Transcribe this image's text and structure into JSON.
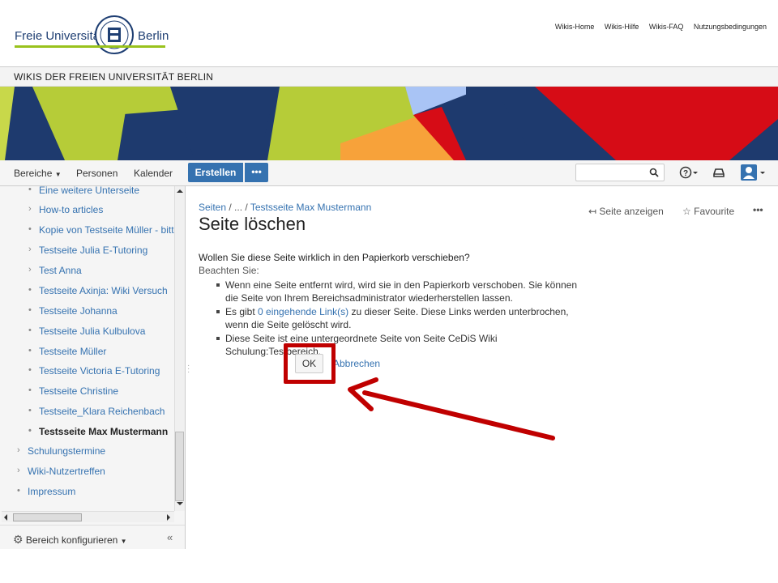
{
  "logo": {
    "left_text": "Freie Universität",
    "right_text": "Berlin"
  },
  "top_links": [
    "Wikis-Home",
    "Wikis-Hilfe",
    "Wikis-FAQ",
    "Nutzungsbedingungen"
  ],
  "wiki_title": "WIKIS DER FREIEN UNIVERSITÄT BERLIN",
  "nav": {
    "spaces": "Bereiche",
    "people": "Personen",
    "calendar": "Kalender",
    "create": "Erstellen",
    "more": "•••",
    "search_placeholder": ""
  },
  "sidebar": {
    "items": [
      {
        "label": "Eine weitere Unterseite",
        "mark": "•"
      },
      {
        "label": "How-to articles",
        "mark": "›"
      },
      {
        "label": "Kopie von Testseite Müller - bitte",
        "mark": "•"
      },
      {
        "label": "Testseite Julia E-Tutoring",
        "mark": "›"
      },
      {
        "label": "Test Anna",
        "mark": "›"
      },
      {
        "label": "Testseite Axinja: Wiki Versuch",
        "mark": "•"
      },
      {
        "label": "Testseite Johanna",
        "mark": "•"
      },
      {
        "label": "Testseite Julia Kulbulova",
        "mark": "•"
      },
      {
        "label": "Testseite Müller",
        "mark": "•"
      },
      {
        "label": "Testseite Victoria E-Tutoring",
        "mark": "•"
      },
      {
        "label": "Testseite Christine",
        "mark": "•"
      },
      {
        "label": "Testseite_Klara Reichenbach",
        "mark": "•"
      },
      {
        "label": "Testsseite Max Mustermann",
        "mark": "•"
      },
      {
        "label": "Schulungstermine",
        "mark": "›"
      },
      {
        "label": "Wiki-Nutzertreffen",
        "mark": "›"
      },
      {
        "label": "Impressum",
        "mark": "•"
      }
    ],
    "configure": "Bereich konfigurieren",
    "collapse": "«"
  },
  "breadcrumb": {
    "root": "Seiten",
    "ellipsis": "...",
    "current": "Testsseite Max Mustermann"
  },
  "page": {
    "title": "Seite löschen",
    "view_page": "Seite anzeigen",
    "favourite": "Favourite",
    "question": "Wollen Sie diese Seite wirklich in den Papierkorb verschieben?",
    "note_label": "Beachten Sie:",
    "bullet1": "Wenn eine Seite entfernt wird, wird sie in den Papierkorb verschoben. Sie können die Seite von Ihrem Bereichsadministrator wiederherstellen lassen.",
    "bullet2_pre": "Es gibt ",
    "bullet2_link": "0 eingehende Link(s)",
    "bullet2_post": " zu dieser Seite. Diese Links werden unterbrochen, wenn die Seite gelöscht wird.",
    "bullet3": "Diese Seite ist eine untergeordnete Seite von Seite CeDiS Wiki Schulung:Testbereich.",
    "ok": "OK",
    "cancel": "Abbrechen"
  },
  "colors": {
    "accent": "#3572b0",
    "highlight": "#c00000"
  }
}
